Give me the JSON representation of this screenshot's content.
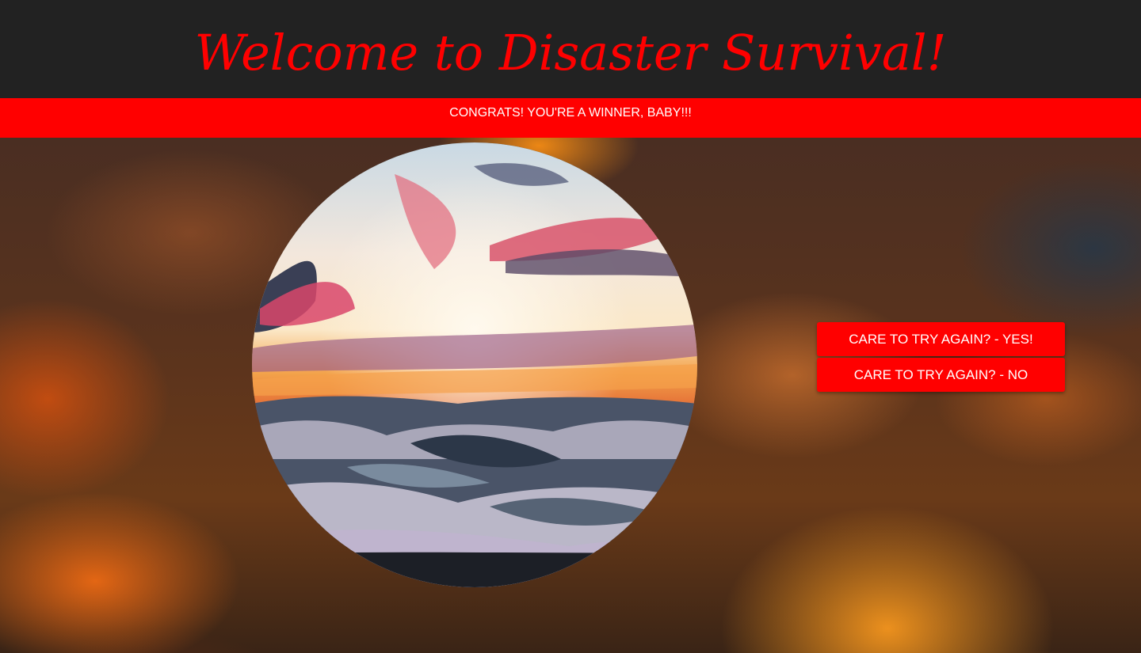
{
  "header": {
    "title": "Welcome to Disaster Survival!"
  },
  "banner": {
    "text": "CONGRATS! YOU'RE A WINNER, BABY!!!"
  },
  "actions": {
    "yes_label": "CARE TO TRY AGAIN? - YES!",
    "no_label": "CARE TO TRY AGAIN? - NO"
  },
  "colors": {
    "accent": "#ff0000",
    "header_bg": "#222222",
    "button_text": "#ffffff"
  }
}
